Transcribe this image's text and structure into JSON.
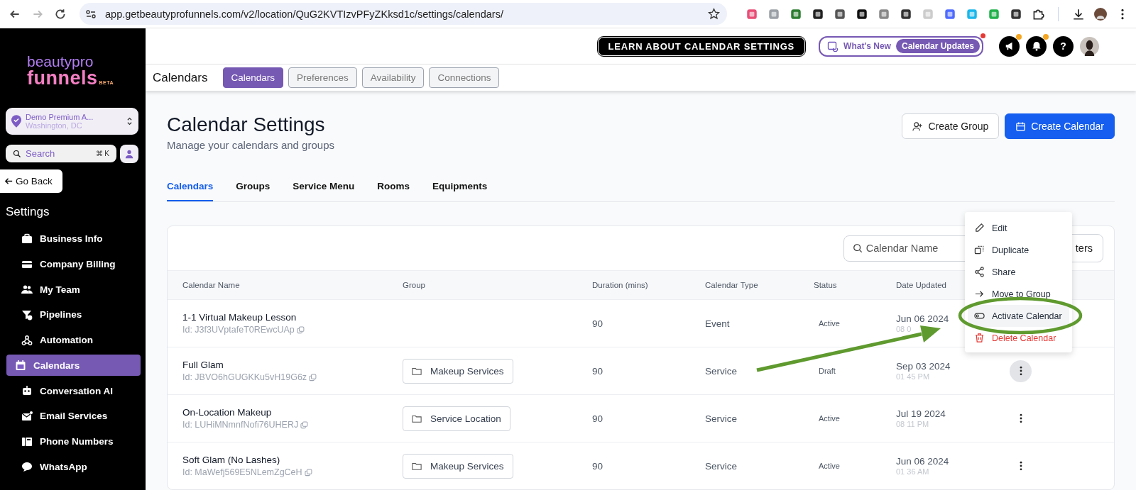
{
  "browser": {
    "url": "app.getbeautyprofunnels.com/v2/location/QuG2KVTIzvPFyZKksd1c/settings/calendars/"
  },
  "header": {
    "learn_button": "LEARN ABOUT CALENDAR SETTINGS",
    "whats_new": "What's New",
    "updates_badge": "Calendar Updates",
    "updates_unread": true,
    "icons": [
      {
        "kind": "megaphone",
        "dot": true
      },
      {
        "kind": "bell",
        "dot": true
      },
      {
        "kind": "help",
        "label": "?"
      }
    ]
  },
  "sidebar": {
    "logo": {
      "line1": "beautypro",
      "line2": "funnels",
      "tag": "BETA"
    },
    "location": {
      "name": "Demo Premium A...",
      "city": "Washington, DC"
    },
    "search": {
      "placeholder": "Search",
      "shortcut": "⌘ K"
    },
    "back": "Go Back",
    "heading": "Settings",
    "items": [
      {
        "label": "Business Info",
        "kind": "briefcase",
        "selected": false
      },
      {
        "label": "Company Billing",
        "kind": "card",
        "selected": false
      },
      {
        "label": "My Team",
        "kind": "people",
        "selected": false
      },
      {
        "label": "Pipelines",
        "kind": "funnel",
        "selected": false
      },
      {
        "label": "Automation",
        "kind": "webhook",
        "selected": false
      },
      {
        "label": "Calendars",
        "kind": "calendar",
        "selected": true
      },
      {
        "label": "Conversation AI",
        "kind": "robot",
        "selected": false
      },
      {
        "label": "Email Services",
        "kind": "envelope",
        "selected": false
      },
      {
        "label": "Phone Numbers",
        "kind": "phone",
        "selected": false
      },
      {
        "label": "WhatsApp",
        "kind": "chat",
        "selected": false
      }
    ]
  },
  "subnav": {
    "title": "Calendars",
    "tabs": [
      {
        "label": "Calendars",
        "selected": true
      },
      {
        "label": "Preferences",
        "selected": false
      },
      {
        "label": "Availability",
        "selected": false
      },
      {
        "label": "Connections",
        "selected": false
      }
    ]
  },
  "page": {
    "title": "Calendar Settings",
    "subtitle": "Manage your calendars and groups",
    "buttons": [
      {
        "label": "Create Group",
        "kind": "secondary"
      },
      {
        "label": "Create Calendar",
        "kind": "primary"
      }
    ],
    "tabs": [
      {
        "label": "Calendars",
        "selected": true
      },
      {
        "label": "Groups",
        "selected": false
      },
      {
        "label": "Service Menu",
        "selected": false
      },
      {
        "label": "Rooms",
        "selected": false
      },
      {
        "label": "Equipments",
        "selected": false
      }
    ]
  },
  "table": {
    "search": {
      "placeholder": "Calendar Name"
    },
    "filter_button": "ters",
    "columns": [
      "Calendar Name",
      "Group",
      "Duration (mins)",
      "Calendar Type",
      "Status",
      "Date Updated"
    ],
    "rows": [
      {
        "name": "1-1 Virtual Makeup Lesson",
        "id": "Id: J3f3UVptafeT0REwcUAp",
        "duration": "90",
        "type": "Event",
        "status": "Active",
        "date": "Jun 06 2024",
        "time": "08 0"
      },
      {
        "name": "Full Glam",
        "id": "Id: JBVO6hGUGKKu5vH19G6z",
        "group": "Makeup Services",
        "duration": "90",
        "type": "Service",
        "status": "Draft",
        "date": "Sep 03 2024",
        "time": "01 45 PM",
        "actions_hovered": true
      },
      {
        "name": "On-Location Makeup",
        "id": "Id: LUHiMNmnfNofi76UHERJ",
        "group": "Service Location",
        "duration": "90",
        "type": "Service",
        "status": "Active",
        "date": "Jul 19 2024",
        "time": "08 11 PM",
        "actions_hovered": false
      },
      {
        "name": "Soft Glam (No Lashes)",
        "id": "Id: MaWefj569E5NLemZgCeH",
        "group": "Makeup Services",
        "duration": "90",
        "type": "Service",
        "status": "Active",
        "date": "Jun 06 2024",
        "time": "01 36 AM",
        "actions_hovered": false
      }
    ]
  },
  "context_menu": {
    "items": [
      {
        "label": "Edit",
        "kind": "pencil",
        "danger": false,
        "highlighted": false
      },
      {
        "label": "Duplicate",
        "kind": "duplicate",
        "danger": false,
        "highlighted": false
      },
      {
        "label": "Share",
        "kind": "share",
        "danger": false,
        "highlighted": false
      },
      {
        "label": "Move to Group",
        "kind": "arrow",
        "danger": false,
        "highlighted": false
      },
      {
        "label": "Activate Calendar",
        "kind": "toggle",
        "danger": false,
        "highlighted": true
      },
      {
        "label": "Delete Calendar",
        "kind": "trash",
        "danger": true,
        "highlighted": false
      }
    ]
  }
}
